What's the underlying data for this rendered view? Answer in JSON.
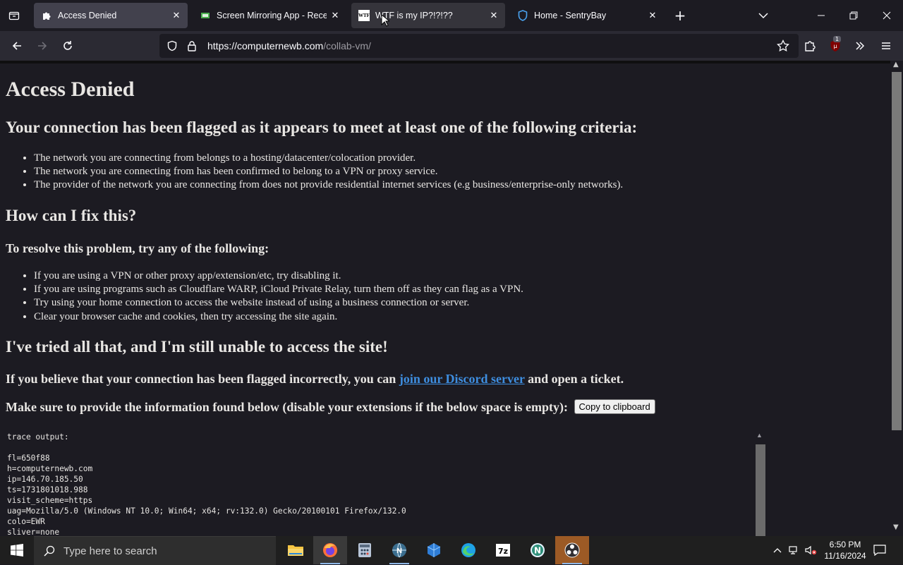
{
  "browser": {
    "tabs": [
      {
        "title": "Access Denied",
        "state": "active"
      },
      {
        "title": "Screen Mirroring App - Receive",
        "state": "normal"
      },
      {
        "title": "WTF is my IP?!?!??",
        "state": "hover",
        "favicon_text": "WTF"
      },
      {
        "title": "Home - SentryBay",
        "state": "normal"
      }
    ],
    "new_tab_symbol": "+",
    "close_symbol": "✕",
    "url": {
      "host_part": "https://computernewb.com",
      "path_part": "/collab-vm/"
    },
    "extension_badge": "1"
  },
  "page": {
    "title": "Access Denied",
    "flagged_heading": "Your connection has been flagged as it appears to meet at least one of the following criteria:",
    "criteria": [
      "The network you are connecting from belongs to a hosting/datacenter/colocation provider.",
      "The network you are connecting from has been confirmed to belong to a VPN or proxy service.",
      "The provider of the network you are connecting from does not provide residential internet services (e.g business/enterprise-only networks)."
    ],
    "fix_heading": "How can I fix this?",
    "resolve_heading": "To resolve this problem, try any of the following:",
    "fixes": [
      "If you are using a VPN or other proxy app/extension/etc, try disabling it.",
      "If you are using programs such as Cloudflare WARP, iCloud Private Relay, turn them off as they can flag as a VPN.",
      "Try using your home connection to access the website instead of using a business connection or server.",
      "Clear your browser cache and cookies, then try accessing the site again."
    ],
    "tried_heading": "I've tried all that, and I'm still unable to access the site!",
    "discord_prefix": "If you believe that your connection has been flagged incorrectly, you can ",
    "discord_link": "join our Discord server",
    "discord_suffix": " and open a ticket.",
    "provide_text": "Make sure to provide the information found below (disable your extensions if the below space is empty): ",
    "copy_button": "Copy to clipboard",
    "trace": "trace output:\n\nfl=650f88\nh=computernewb.com\nip=146.70.185.50\nts=1731801018.988\nvisit_scheme=https\nuag=Mozilla/5.0 (Windows NT 10.0; Win64; x64; rv:132.0) Gecko/20100101 Firefox/132.0\ncolo=EWR\nsliver=none"
  },
  "taskbar": {
    "search_placeholder": "Type here to search",
    "apps": [
      "file-explorer",
      "firefox",
      "calculator-app",
      "network-app",
      "app-installer",
      "edge",
      "7zip",
      "notepad-n",
      "obs"
    ],
    "app_labels": {
      "sevenzip": "7z",
      "network": "N"
    },
    "time": "6:50 PM",
    "date": "11/16/2024"
  },
  "colors": {
    "accent_link": "#3e8ee0",
    "background": "#1c1b22",
    "toolbar": "#2b2a33"
  }
}
